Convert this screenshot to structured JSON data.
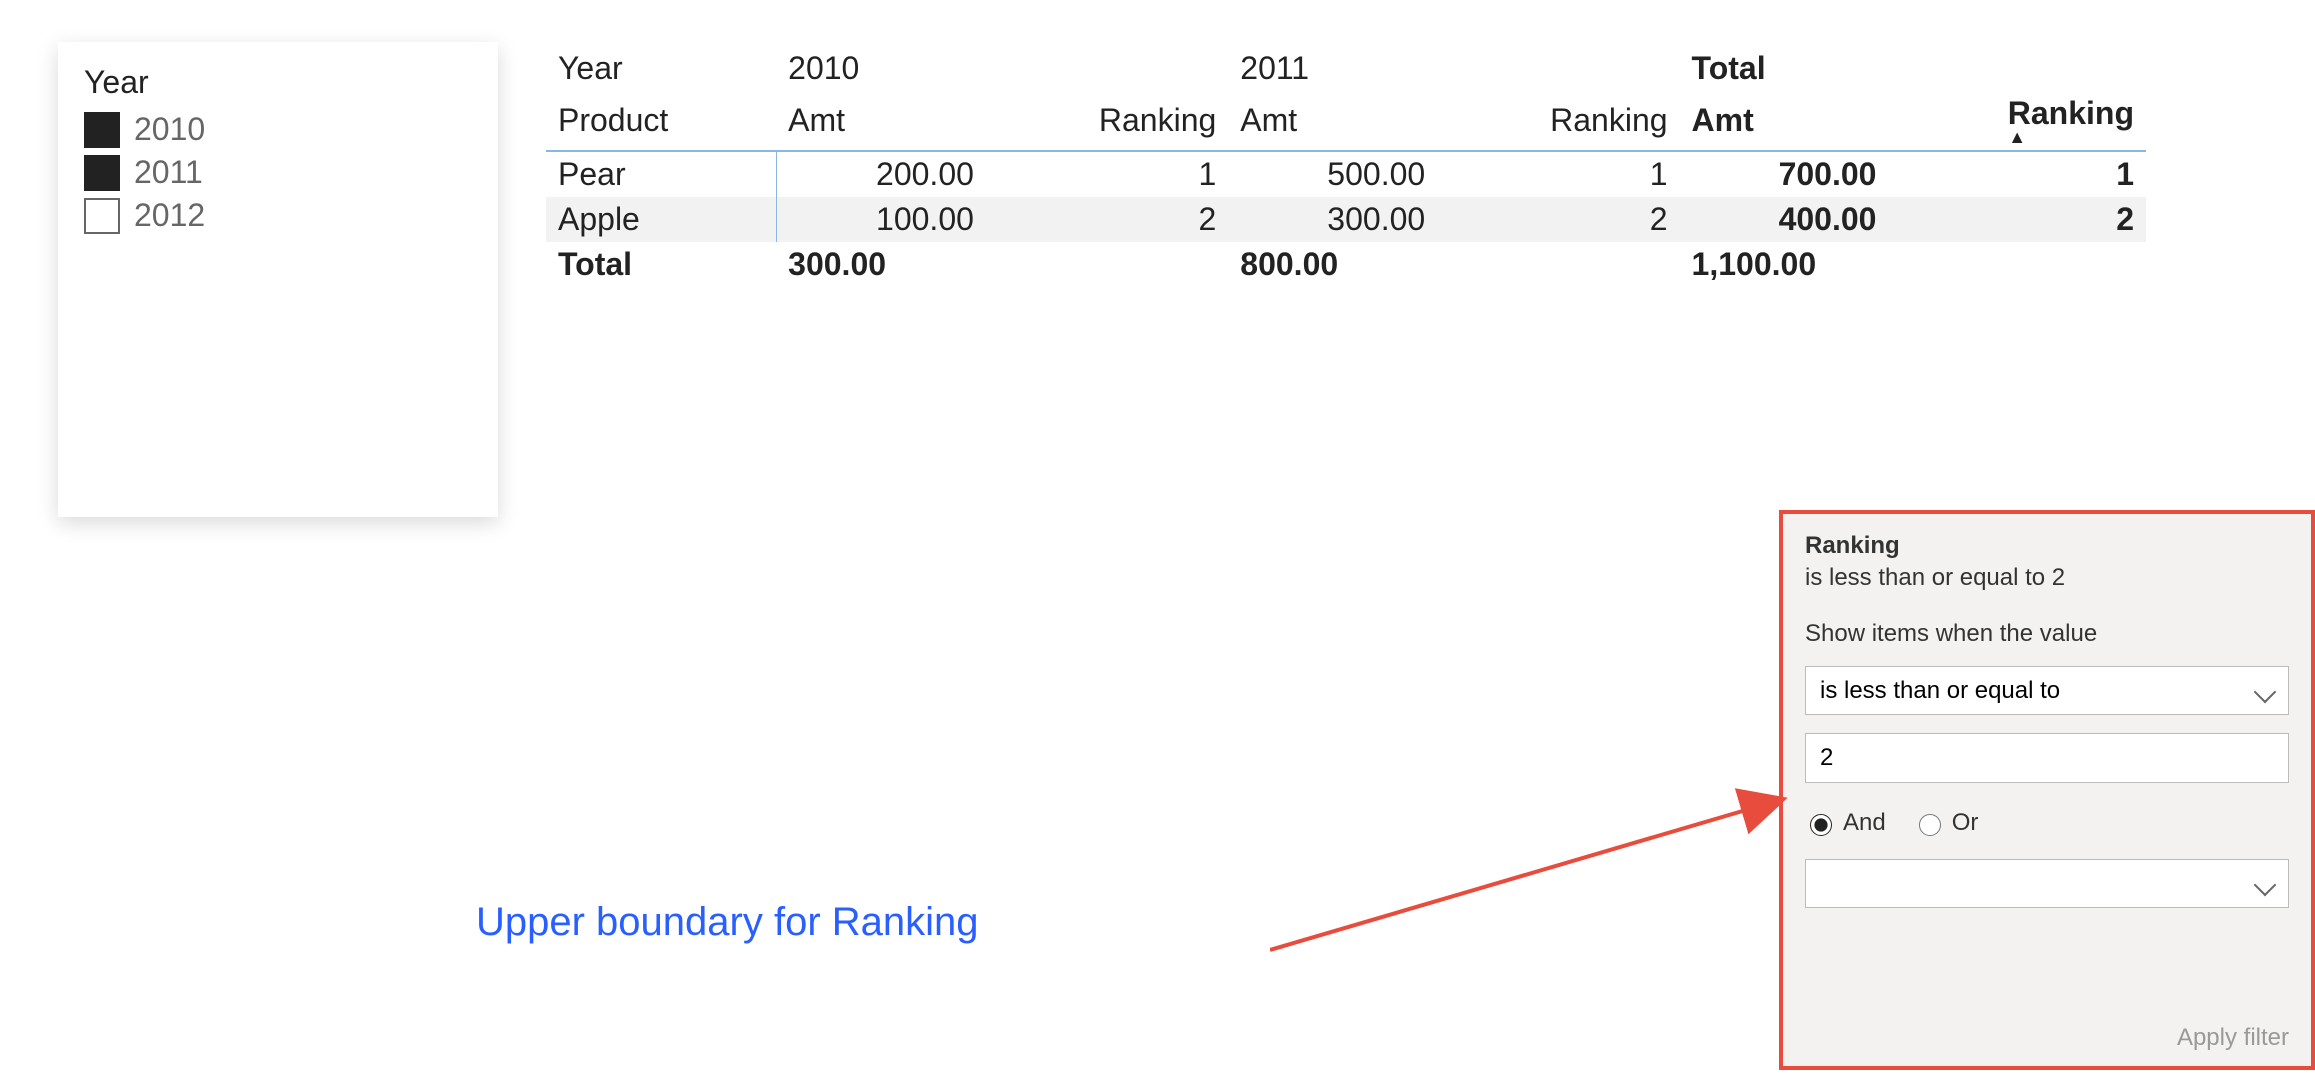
{
  "slicer": {
    "title": "Year",
    "items": [
      {
        "label": "2010",
        "checked": true
      },
      {
        "label": "2011",
        "checked": true
      },
      {
        "label": "2012",
        "checked": false
      }
    ]
  },
  "matrix": {
    "header": {
      "row1_col0": "Year",
      "row1_g1": "2010",
      "row1_g2": "2011",
      "row1_total": "Total",
      "row2_col0": "Product",
      "amt": "Amt",
      "ranking": "Ranking"
    },
    "rows": [
      {
        "product": "Pear",
        "amt1": "200.00",
        "rk1": "1",
        "amt2": "500.00",
        "rk2": "1",
        "amtT": "700.00",
        "rkT": "1"
      },
      {
        "product": "Apple",
        "amt1": "100.00",
        "rk1": "2",
        "amt2": "300.00",
        "rk2": "2",
        "amtT": "400.00",
        "rkT": "2"
      }
    ],
    "total": {
      "label": "Total",
      "amt1": "300.00",
      "amt2": "800.00",
      "amtT": "1,100.00"
    }
  },
  "filter": {
    "title": "Ranking",
    "summary": "is less than or equal to 2",
    "prompt": "Show items when the value",
    "condition1": "is less than or equal to",
    "value1": "2",
    "logic_and": "And",
    "logic_or": "Or",
    "condition2": "",
    "apply": "Apply filter"
  },
  "annotation": {
    "text": "Upper boundary for Ranking"
  },
  "chart_data": {
    "type": "table",
    "title": "Amt and Ranking by Product and Year",
    "columns": [
      "Product",
      "2010 Amt",
      "2010 Ranking",
      "2011 Amt",
      "2011 Ranking",
      "Total Amt",
      "Total Ranking"
    ],
    "rows": [
      [
        "Pear",
        200.0,
        1,
        500.0,
        1,
        700.0,
        1
      ],
      [
        "Apple",
        100.0,
        2,
        300.0,
        2,
        400.0,
        2
      ]
    ],
    "totals": [
      "Total",
      300.0,
      null,
      800.0,
      null,
      1100.0,
      null
    ],
    "filter": {
      "field": "Ranking",
      "op": "<=",
      "value": 2
    },
    "sort": {
      "column": "Total Ranking",
      "dir": "asc"
    }
  }
}
